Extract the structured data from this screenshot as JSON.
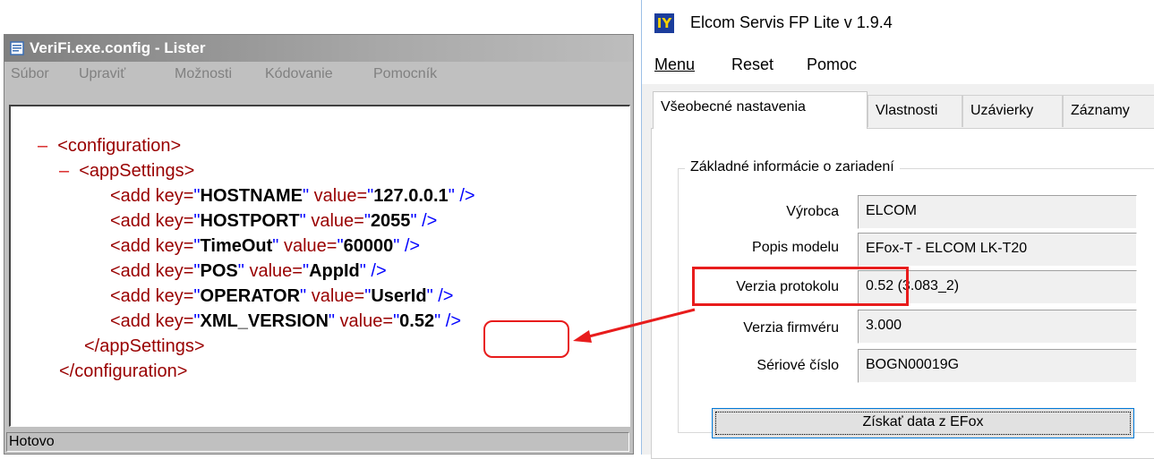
{
  "lister": {
    "title": "VeriFi.exe.config - Lister",
    "menu": [
      "Súbor",
      "Upraviť",
      "Možnosti",
      "Kódovanie",
      "Pomocník"
    ],
    "xml": {
      "toggle": "–",
      "configuration_open": "<configuration>",
      "appsettings_open": "<appSettings>",
      "entries": [
        {
          "key": "HOSTNAME",
          "value": "127.0.0.1"
        },
        {
          "key": "HOSTPORT",
          "value": "2055"
        },
        {
          "key": "TimeOut",
          "value": "60000"
        },
        {
          "key": "POS",
          "value": "AppId"
        },
        {
          "key": "OPERATOR",
          "value": "UserId"
        },
        {
          "key": "XML_VERSION",
          "value": "0.52"
        }
      ],
      "add_prefix": "<add key=",
      "value_prefix": " value=",
      "quote": "\"",
      "close": " />",
      "appsettings_close": "</appSettings>",
      "configuration_close": "</configuration>"
    },
    "status": "Hotovo"
  },
  "elcom": {
    "title": "Elcom Servis FP Lite v 1.9.4",
    "logo_text": "IY",
    "menu": [
      "Menu",
      "Reset",
      "Pomoc"
    ],
    "tabs": [
      "Všeobecné nastavenia",
      "Vlastnosti",
      "Uzávierky",
      "Záznamy"
    ],
    "group_title": "Základné informácie o zariadení",
    "fields": [
      {
        "label": "Výrobca",
        "value": "ELCOM"
      },
      {
        "label": "Popis modelu",
        "value": "EFox-T - ELCOM LK-T20"
      },
      {
        "label": "Verzia protokolu",
        "value": "0.52 (3.083_2)"
      },
      {
        "label": "Verzia firmvéru",
        "value": "3.000"
      },
      {
        "label": "Sériové číslo",
        "value": "BOGN00019G"
      }
    ],
    "button": "Získať data z EFox"
  },
  "colors": {
    "highlight": "#e81c1c",
    "xml_tag": "#990000",
    "xml_quote": "#0000ff"
  }
}
